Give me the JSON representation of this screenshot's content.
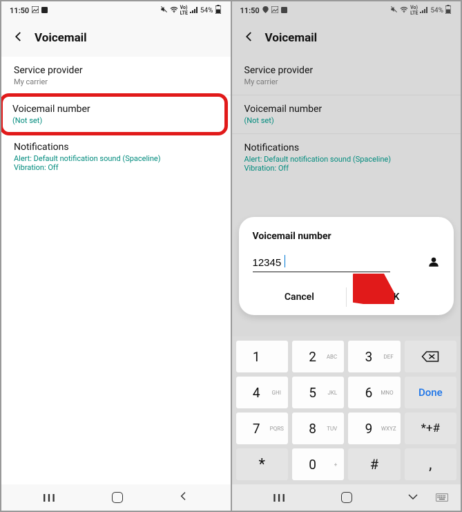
{
  "status": {
    "time": "11:50",
    "battery": "54%"
  },
  "header": {
    "title": "Voicemail"
  },
  "settings": {
    "provider": {
      "title": "Service provider",
      "sub": "My carrier"
    },
    "vm_number": {
      "title": "Voicemail number",
      "sub": "(Not set)"
    },
    "notifications": {
      "title": "Notifications",
      "alert": "Alert: Default notification sound (Spaceline)",
      "vibration": "Vibration: Off"
    }
  },
  "dialog": {
    "title": "Voicemail number",
    "value": "12345",
    "cancel": "Cancel",
    "ok": "OK"
  },
  "keypad": {
    "k1": "1",
    "k2": "2",
    "k2l": "ABC",
    "k3": "3",
    "k3l": "DEF",
    "k4": "4",
    "k4l": "GHI",
    "k5": "5",
    "k5l": "JKL",
    "k6": "6",
    "k6l": "MNO",
    "k7": "7",
    "k7l": "PQRS",
    "k8": "8",
    "k8l": "TUV",
    "k9": "9",
    "k9l": "WXYZ",
    "star": "*",
    "k0": "0",
    "k0l": "+",
    "hash": "#",
    "done": "Done",
    "symkey": "*+#",
    "comma": ","
  },
  "chart_data": null
}
